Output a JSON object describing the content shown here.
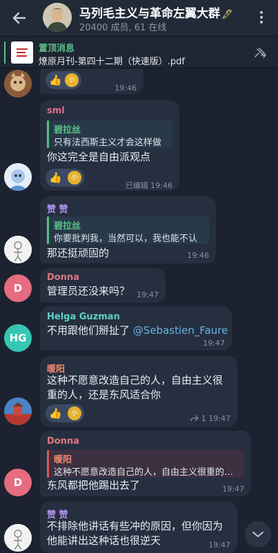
{
  "header": {
    "title": "马列毛主义与革命左翼大群",
    "title_badge": "🖋",
    "subtitle": "20400 成员, 61 在线"
  },
  "pinned": {
    "label": "置顶消息",
    "text": "燎原月刊-第四十二期（快速版）.pdf"
  },
  "reaction_label": "小",
  "messages": [
    {
      "time": "19:46"
    },
    {
      "sender": "sml",
      "reply_to": "碧拉丝",
      "reply_text": "只有法西斯主义才会这样做",
      "text": "你这完全是自由派观点",
      "edited_label": "已编辑",
      "time": "19:46"
    },
    {
      "sender": "赞 赞",
      "reply_to": "碧拉丝",
      "reply_text": "你要批判我，当然可以，我也能不认",
      "text": "那还挺顽固的",
      "time": "19:46"
    },
    {
      "sender": "Donna",
      "avatar_letter": "D",
      "text": "管理员还没来吗？",
      "time": "19:47"
    },
    {
      "sender": "Helga Guzman",
      "avatar_letter": "HG",
      "text": "不用跟他们掰扯了",
      "mention": "@Sebastien_Faure",
      "time": "19:47"
    },
    {
      "sender": "暖阳",
      "text_line1": "这种不愿意改造自己的人，自由主义很",
      "text_line2": "重的人，还是东风适合你",
      "share_count": "1",
      "time": "19:47"
    },
    {
      "sender": "Donna",
      "avatar_letter": "D",
      "reply_to": "暖阳",
      "reply_text": "这种不愿意改造自己的人，自由主义很重的…",
      "text": "东风都把他踢出去了",
      "time": "19:47"
    },
    {
      "sender": "赞 赞",
      "text_line1": "不排除他讲话有些冲的原因，但你因为",
      "text_line2": "他能讲出这种话也很逆天",
      "time": "19:47"
    }
  ],
  "colors": {
    "background": "#1c2230",
    "bubble": "#262f3f",
    "sml_name": "#e0728f",
    "zanzan_name": "#b193f0",
    "donna_name": "#e07883",
    "helga_name": "#5ed2c8",
    "nuanyang_name": "#f08a72",
    "reply_bilasi": "#5bbf87",
    "reply_nuanyang": "#e25555",
    "mention": "#67b3e6"
  }
}
